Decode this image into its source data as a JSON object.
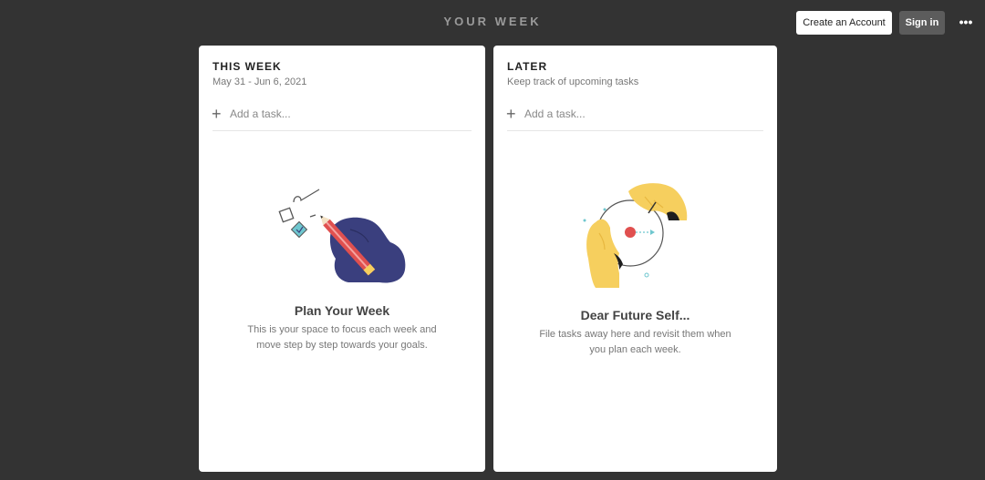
{
  "header": {
    "title": "YOUR WEEK",
    "create_account_label": "Create an Account",
    "sign_in_label": "Sign in",
    "more_icon": "•••"
  },
  "this_week": {
    "title": "THIS WEEK",
    "date_range": "May 31 - Jun 6, 2021",
    "add_task_label": "Add a task...",
    "empty_title": "Plan Your Week",
    "empty_desc": "This is your space to focus each week and move step by step towards your goals."
  },
  "later": {
    "title": "LATER",
    "subtitle": "Keep track of upcoming tasks",
    "add_task_label": "Add a task...",
    "empty_title": "Dear Future Self...",
    "empty_desc": "File tasks away here and revisit them when you plan each week."
  },
  "colors": {
    "background": "#333333",
    "card": "#ffffff",
    "hand_navy": "#3a3f7e",
    "pencil_red": "#e0504f",
    "hand_yellow": "#f6cf5e",
    "check_teal": "#6fc7cf"
  },
  "icons": {
    "plus": "+",
    "plan_illustration": "hand-writing-checklist-illustration",
    "future_illustration": "hands-holding-clock-illustration"
  }
}
